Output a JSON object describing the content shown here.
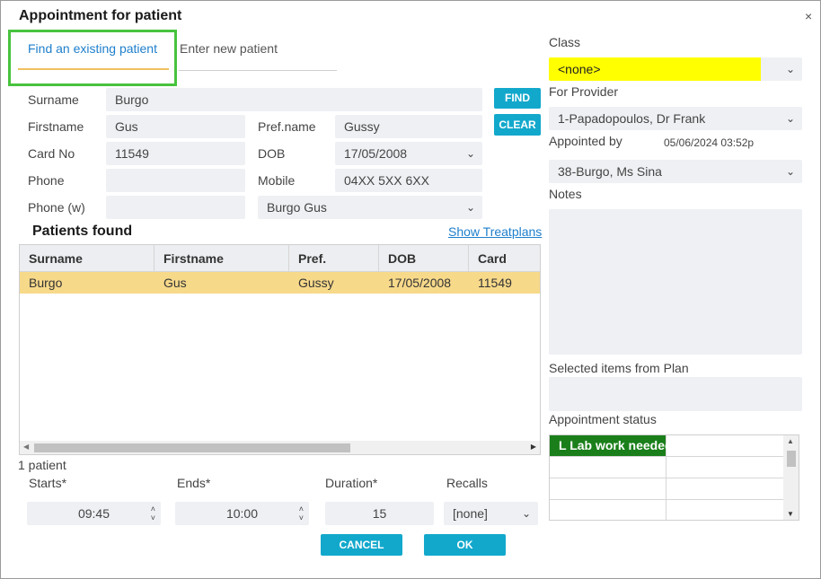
{
  "window": {
    "title": "Appointment for patient",
    "close_glyph": "×"
  },
  "tabs": {
    "existing": "Find an existing patient",
    "new": "Enter new patient"
  },
  "search": {
    "surname_label": "Surname",
    "surname_value": "Burgo",
    "firstname_label": "Firstname",
    "firstname_value": "Gus",
    "prefname_label": "Pref.name",
    "prefname_value": "Gussy",
    "cardno_label": "Card No",
    "cardno_value": "11549",
    "dob_label": "DOB",
    "dob_value": "17/05/2008",
    "phone_label": "Phone",
    "phone_value": "",
    "mobile_label": "Mobile",
    "mobile_value": "04XX 5XX 6XX",
    "phonew_label": "Phone (w)",
    "phonew_value": "",
    "family_value": "Burgo Gus",
    "find_label": "FIND",
    "clear_label": "CLEAR"
  },
  "patients": {
    "title": "Patients found",
    "show_treatplans": "Show Treatplans",
    "columns": [
      "Surname",
      "Firstname",
      "Pref.",
      "DOB",
      "Card"
    ],
    "rows": [
      [
        "Burgo",
        "Gus",
        "Gussy",
        "17/05/2008",
        "11549"
      ]
    ],
    "count_text": "1 patient"
  },
  "appointment": {
    "starts_label": "Starts*",
    "starts_value": "09:45",
    "ends_label": "Ends*",
    "ends_value": "10:00",
    "duration_label": "Duration*",
    "duration_value": "15",
    "recalls_label": "Recalls",
    "recalls_value": "[none]",
    "cancel_label": "CANCEL",
    "ok_label": "OK"
  },
  "right": {
    "class_label": "Class",
    "class_value": "<none>",
    "provider_label": "For Provider",
    "provider_value": "1-Papadopoulos, Dr Frank",
    "appointed_label": "Appointed by",
    "appointed_time": "05/06/2024 03:52p",
    "appointed_value": "38-Burgo, Ms Sina",
    "notes_label": "Notes",
    "plan_label": "Selected items from Plan",
    "status_label": "Appointment status",
    "status_value": "L Lab work needed"
  },
  "colors": {
    "accent": "#12a8cc",
    "highlight_row": "#f7d98a",
    "class_yellow": "#ffff00",
    "status_green": "#1a7f1a",
    "tab_blue": "#1e7fcc",
    "focus_green": "#48c33e"
  },
  "icons": {
    "chevron": "chevron-down-icon",
    "spinner": "spinner-arrows-icon",
    "close": "close-icon"
  }
}
